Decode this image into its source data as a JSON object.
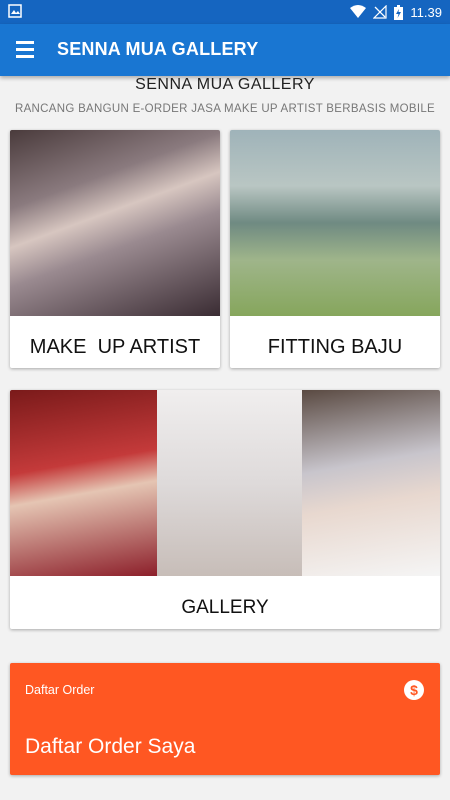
{
  "status_bar": {
    "time": "11.39",
    "icons": [
      "image-icon",
      "wifi-icon",
      "no-signal-icon",
      "battery-charging-icon"
    ]
  },
  "app_bar": {
    "title": "SENNA MUA GALLERY",
    "menu_icon": "hamburger-menu-icon"
  },
  "header": {
    "title": "SENNA MUA GALLERY",
    "subtitle": "RANCANG BANGUN E-ORDER JASA MAKE UP ARTIST BERBASIS MOBILE"
  },
  "cards": {
    "make_up_artist": {
      "label": "MAKE  UP ARTIST"
    },
    "fitting_baju": {
      "label": "FITTING BAJU"
    },
    "gallery": {
      "label": "GALLERY"
    }
  },
  "order_card": {
    "small_label": "Daftar Order",
    "big_label": "Daftar Order Saya",
    "icon": "dollar-icon"
  },
  "colors": {
    "status_bar": "#1565c0",
    "app_bar": "#1976d2",
    "order_card": "#ff5722",
    "background": "#f2f2f2"
  }
}
